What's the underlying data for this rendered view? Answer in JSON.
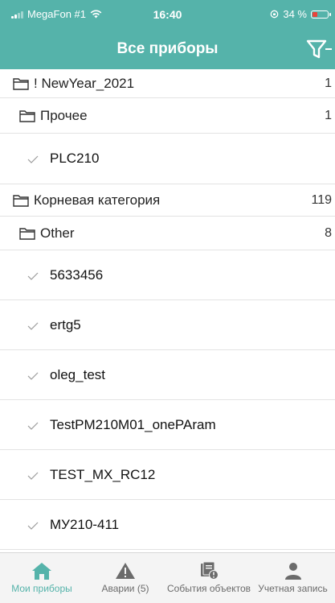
{
  "status_bar": {
    "carrier": "MegaFon #1",
    "time": "16:40",
    "battery": "34 %",
    "battery_level": 0.34
  },
  "header": {
    "title": "Все приборы",
    "filter_icon": "filter-icon"
  },
  "colors": {
    "accent": "#55b3aa",
    "battery_low": "#e8453c",
    "tab_inactive": "#6b6b6b"
  },
  "list": {
    "groups": [
      {
        "label": "! NewYear_2021",
        "count": "1"
      },
      {
        "label": "Прочее",
        "count": "1"
      },
      {
        "label": "Корневая категория",
        "count": "119"
      },
      {
        "label": "Other",
        "count": "8"
      }
    ],
    "devices_a": [
      {
        "label": "PLC210"
      }
    ],
    "devices_b": [
      {
        "label": "5633456"
      },
      {
        "label": "ertg5"
      },
      {
        "label": "oleg_test"
      },
      {
        "label": "TestPM210M01_onePAram"
      },
      {
        "label": "TEST_MX_RC12"
      },
      {
        "label": "МУ210-411"
      }
    ]
  },
  "tabbar": {
    "tabs": [
      {
        "label": "Мои приборы",
        "icon": "home-icon",
        "active": true
      },
      {
        "label": "Аварии (5)",
        "icon": "warning-icon",
        "active": false
      },
      {
        "label": "События объектов",
        "icon": "events-icon",
        "active": false
      },
      {
        "label": "Учетная запись",
        "icon": "account-icon",
        "active": false
      }
    ]
  }
}
